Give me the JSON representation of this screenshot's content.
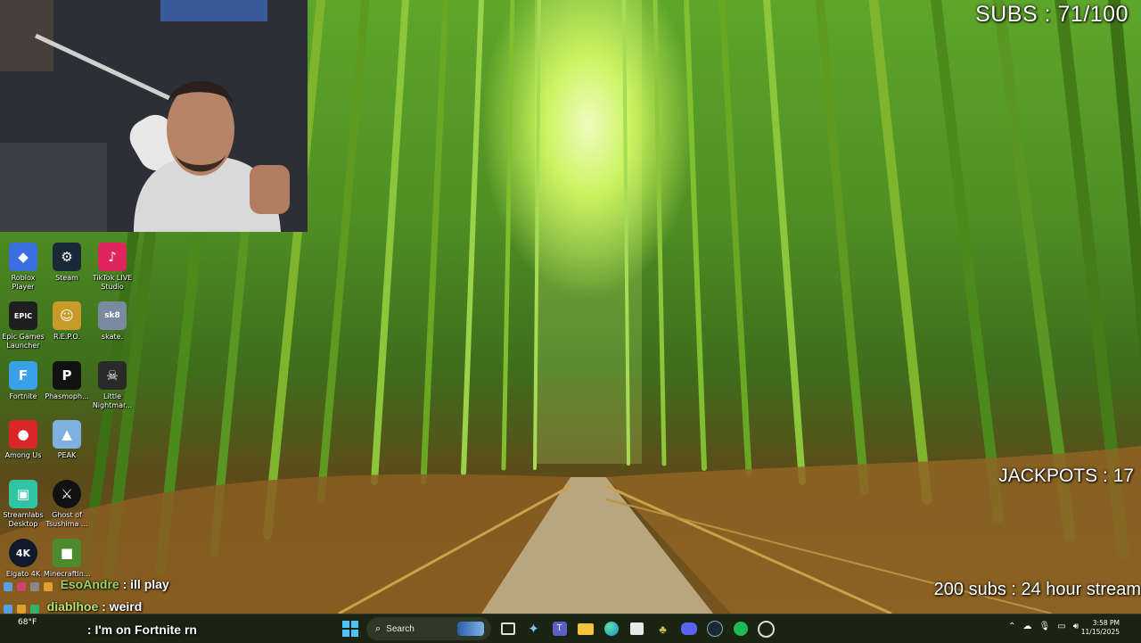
{
  "overlay": {
    "subs": "SUBS : 71/100",
    "jackpots": "JACKPOTS : 17",
    "goal": "200 subs : 24 hour stream"
  },
  "desktop_icons": [
    {
      "label": "Roblox Player",
      "icon": "roblox-icon",
      "glyph": "◆",
      "color": "#3b6fe0"
    },
    {
      "label": "Steam",
      "icon": "steam-icon",
      "glyph": "⚙",
      "color": "#1b2838"
    },
    {
      "label": "TikTok LIVE Studio",
      "icon": "tiktok-icon",
      "glyph": "♪",
      "color": "#e0245e"
    },
    {
      "label": "Epic Games Launcher",
      "icon": "epic-games-icon",
      "glyph": "EPIC",
      "color": "#1f1f1f"
    },
    {
      "label": "R.E.P.O.",
      "icon": "repo-icon",
      "glyph": "☺",
      "color": "#c79a2a"
    },
    {
      "label": "skate.",
      "icon": "skate-icon",
      "glyph": "sk8",
      "color": "#7a8aa0"
    },
    {
      "label": "Fortnite",
      "icon": "fortnite-icon",
      "glyph": "F",
      "color": "#3aa0e8"
    },
    {
      "label": "Phasmoph...",
      "icon": "phasmophobia-icon",
      "glyph": "P",
      "color": "#111111"
    },
    {
      "label": "Little Nightmar...",
      "icon": "little-nightmares-icon",
      "glyph": "☠",
      "color": "#2a2a2a"
    },
    {
      "label": "Among Us",
      "icon": "among-us-icon",
      "glyph": "●",
      "color": "#d8262a"
    },
    {
      "label": "PEAK",
      "icon": "peak-icon",
      "glyph": "▲",
      "color": "#7fb0e0"
    },
    {
      "label": "Streamlabs Desktop",
      "icon": "streamlabs-icon",
      "glyph": "▣",
      "color": "#31c3a2"
    },
    {
      "label": "Ghost of Tsushima ...",
      "icon": "ghost-of-tsushima-icon",
      "glyph": "⚔",
      "color": "#111111"
    },
    {
      "label": "Elgato 4K",
      "icon": "elgato-4k-icon",
      "glyph": "4K",
      "color": "#101a2a"
    },
    {
      "label": "Minecraftln...",
      "icon": "minecraft-icon",
      "glyph": "■",
      "color": "#4c8a2c"
    }
  ],
  "chat": [
    {
      "user": "EsoAndre",
      "msg": ": ill play"
    },
    {
      "user": "diablhoe",
      "msg": ": weird"
    },
    {
      "user": "",
      "msg": ": I'm on Fortnite rn"
    }
  ],
  "taskbar": {
    "weather": "68°F",
    "search_label": "Search",
    "time": "3:58 PM",
    "date": "11/15/2025"
  }
}
